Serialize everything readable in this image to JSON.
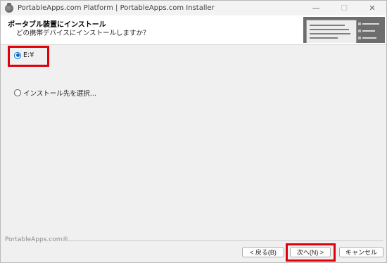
{
  "window": {
    "title": "PortableApps.com Platform | PortableApps.com Installer",
    "controls": {
      "minimize": "—",
      "maximize": "☐",
      "close": "✕"
    }
  },
  "header": {
    "title": "ポータブル装置にインストール",
    "subtitle": "どの携帯デバイスにインストールしますか？"
  },
  "options": [
    {
      "label": "E:¥",
      "selected": true
    },
    {
      "label": "インストール先を選択...",
      "selected": false
    }
  ],
  "footer": {
    "brand": "PortableApps.com®",
    "back_label": "< 戻る(B)",
    "next_label": "次へ(N) >",
    "cancel_label": "キャンセル"
  },
  "colors": {
    "highlight": "#e0000c",
    "radio_selected": "#0066cc"
  }
}
